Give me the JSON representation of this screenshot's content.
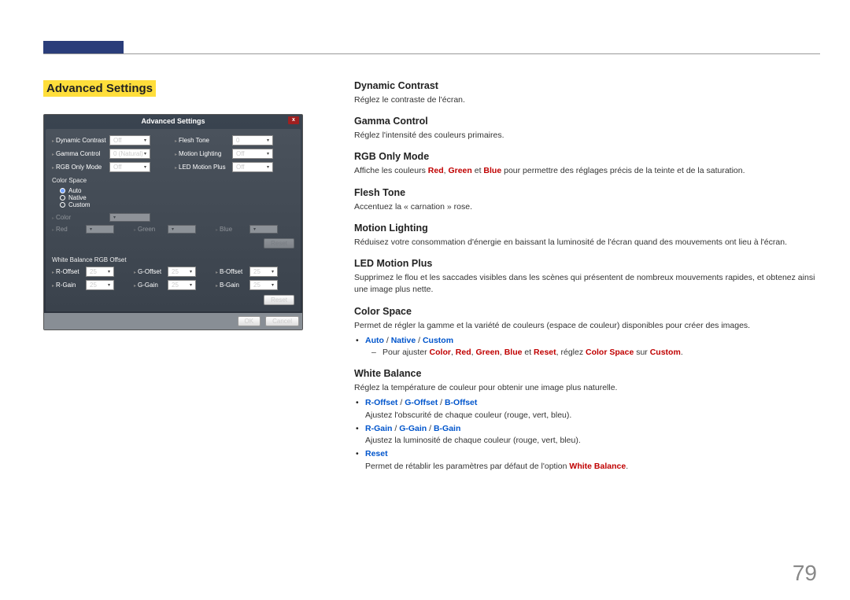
{
  "page_number": "79",
  "section_title": "Advanced Settings",
  "panel": {
    "title": "Advanced Settings",
    "close_label": "x",
    "row1": {
      "dynamic_contrast_label": "Dynamic Contrast",
      "dynamic_contrast_value": "Off",
      "flesh_tone_label": "Flesh Tone",
      "flesh_tone_value": "0"
    },
    "row2": {
      "gamma_control_label": "Gamma Control",
      "gamma_control_value": "0 (Natural)",
      "motion_lighting_label": "Motion Lighting",
      "motion_lighting_value": "Off"
    },
    "row3": {
      "rgb_only_label": "RGB Only Mode",
      "rgb_only_value": "Off",
      "led_motion_label": "LED Motion Plus",
      "led_motion_value": "Off"
    },
    "color_space_head": "Color Space",
    "cs_auto": "Auto",
    "cs_native": "Native",
    "cs_custom": "Custom",
    "cs_color": "Color",
    "cs_red": "Red",
    "cs_green": "Green",
    "cs_blue": "Blue",
    "cs_reset": "Reset",
    "wb_head": "White Balance RGB Offset",
    "wb": {
      "r_offset_l": "R-Offset",
      "r_offset_v": "25",
      "g_offset_l": "G-Offset",
      "g_offset_v": "25",
      "b_offset_l": "B-Offset",
      "b_offset_v": "25",
      "r_gain_l": "R-Gain",
      "r_gain_v": "25",
      "g_gain_l": "G-Gain",
      "g_gain_v": "25",
      "b_gain_l": "B-Gain",
      "b_gain_v": "25"
    },
    "wb_reset": "Reset",
    "ok": "OK",
    "cancel": "Cancel"
  },
  "dynamic_contrast": {
    "h": "Dynamic Contrast",
    "p": "Réglez le contraste de l'écran."
  },
  "gamma_control": {
    "h": "Gamma Control",
    "p": "Réglez l'intensité des couleurs primaires."
  },
  "rgb_only": {
    "h": "RGB Only Mode",
    "p_pre": "Affiche les couleurs ",
    "red": "Red",
    "comma1": ", ",
    "green": "Green",
    "and": " et ",
    "blue": "Blue",
    "p_post": " pour permettre des réglages précis de la teinte et de la saturation."
  },
  "flesh_tone": {
    "h": "Flesh Tone",
    "p": "Accentuez la « carnation » rose."
  },
  "motion_lighting": {
    "h": "Motion Lighting",
    "p": "Réduisez votre consommation d'énergie en baissant la luminosité de l'écran quand des mouvements ont lieu à l'écran."
  },
  "led_motion": {
    "h": "LED Motion Plus",
    "p": "Supprimez le flou et les saccades visibles dans les scènes qui présentent de nombreux mouvements rapides, et obtenez ainsi une image plus nette."
  },
  "color_space": {
    "h": "Color Space",
    "p": "Permet de régler la gamme et la variété de couleurs (espace de couleur) disponibles pour créer des images.",
    "b1_auto": "Auto",
    "slash1": " / ",
    "b1_native": "Native",
    "slash2": " / ",
    "b1_custom": "Custom",
    "sub_pre": "Pour ajuster ",
    "sub_color": "Color",
    "c1": ", ",
    "sub_red": "Red",
    "c2": ", ",
    "sub_green": "Green",
    "c3": ", ",
    "sub_blue": "Blue",
    "sub_and": " et ",
    "sub_reset": "Reset",
    "sub_mid": ", réglez ",
    "sub_cs": "Color Space",
    "sub_on": " sur ",
    "sub_cust": "Custom",
    "sub_end": "."
  },
  "white_balance": {
    "h": "White Balance",
    "p": "Réglez la température de couleur pour obtenir une image plus naturelle.",
    "b1_r": "R-Offset",
    "s1": " / ",
    "b1_g": "G-Offset",
    "s2": " / ",
    "b1_b": "B-Offset",
    "b1_desc": "Ajustez l'obscurité de chaque couleur (rouge, vert, bleu).",
    "b2_r": "R-Gain",
    "s3": " / ",
    "b2_g": "G-Gain",
    "s4": " / ",
    "b2_b": "B-Gain",
    "b2_desc": "Ajustez la luminosité de chaque couleur (rouge, vert, bleu).",
    "b3": "Reset",
    "b3_pre": "Permet de rétablir les paramètres par défaut de l'option ",
    "b3_wb": "White Balance",
    "b3_end": "."
  }
}
